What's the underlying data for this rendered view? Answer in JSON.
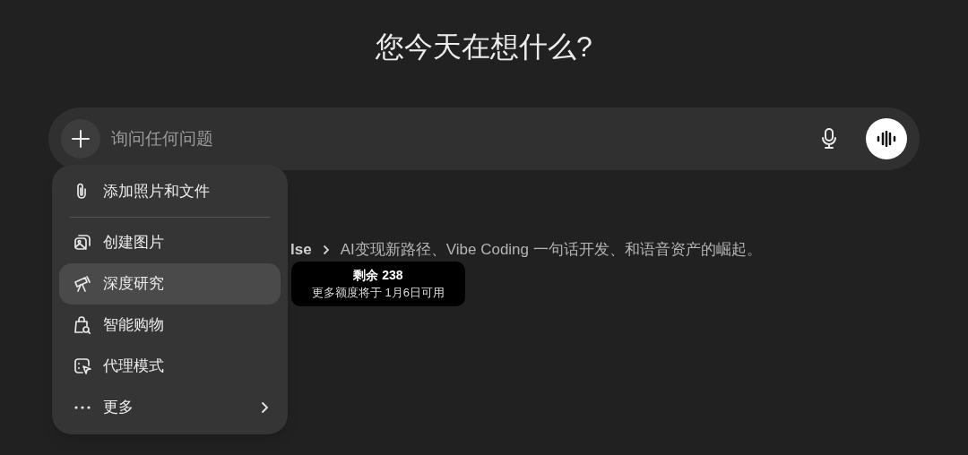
{
  "heading": "您今天在想什么?",
  "composer": {
    "placeholder": "询问任何问题"
  },
  "background_line": {
    "fragment": "lse",
    "text": "AI变现新路径、Vibe Coding 一句话开发、和语音资产的崛起。"
  },
  "menu": {
    "items": [
      {
        "label": "添加照片和文件",
        "kind": "attach",
        "selected": false
      },
      {
        "label": "创建图片",
        "kind": "image",
        "selected": false
      },
      {
        "label": "深度研究",
        "kind": "research",
        "selected": true
      },
      {
        "label": "智能购物",
        "kind": "shopping",
        "selected": false
      },
      {
        "label": "代理模式",
        "kind": "agent",
        "selected": false
      },
      {
        "label": "更多",
        "kind": "more",
        "selected": false
      }
    ]
  },
  "tooltip": {
    "title": "剩余 238",
    "text": "更多额度将于 1月6日可用"
  }
}
